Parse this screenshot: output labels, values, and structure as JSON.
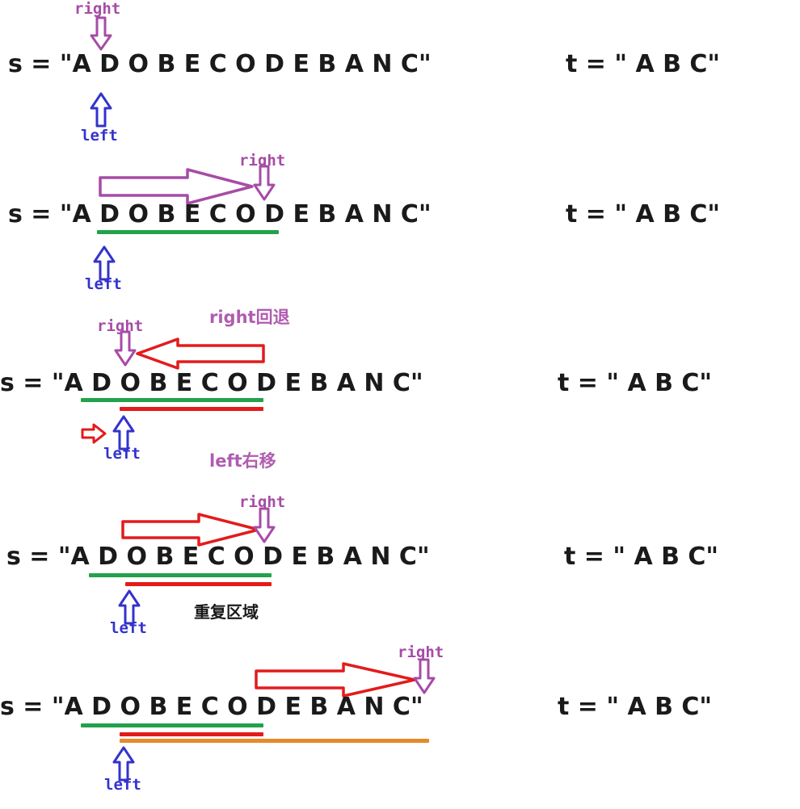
{
  "diagram": {
    "title": "Sliding window minimum-window-substring walkthrough",
    "colors": {
      "right_pointer": "#a64ca6",
      "left_pointer": "#3333cc",
      "window_green": "#22a24a",
      "window_red": "#e31b1b",
      "window_orange": "#e8892b",
      "text": "#1a1a1a",
      "background": "#ffffff"
    },
    "labels": {
      "right": "right",
      "left": "left",
      "right_retreat": "right回退",
      "left_shift_right": "left右移",
      "duplicate_region": "重复区域"
    },
    "strings": {
      "s_expr": "s = \"A D O B E C O D E B A N C\"",
      "t_expr": "t = \" A B C\"",
      "s_value": "ADOBECODEBANC",
      "t_value": "ABC"
    },
    "steps": [
      {
        "id": "step-1",
        "right_label": "right",
        "left_label": "left",
        "s_expr": "s = \"A D O B E C O D E B A N C\"",
        "t_expr": "t = \" A B C\"",
        "annotations": [],
        "underlines": []
      },
      {
        "id": "step-2",
        "right_label": "right",
        "left_label": "left",
        "s_expr": "s = \"A D O B E C O D E B A N C\"",
        "t_expr": "t = \" A B C\"",
        "annotations": [],
        "underlines": [
          "green"
        ],
        "move_arrow": "purple-right-arrow"
      },
      {
        "id": "step-3",
        "right_label": "right",
        "left_label": "left",
        "s_expr": "s = \"A D O B E C O D E B A N C\"",
        "t_expr": "t = \" A B C\"",
        "annotations": [
          "right回退",
          "left右移"
        ],
        "underlines": [
          "green",
          "red"
        ],
        "move_arrow": "red-left-arrow"
      },
      {
        "id": "step-4",
        "right_label": "right",
        "left_label": "left",
        "s_expr": "s = \"A D O B E C O D E B A N C\"",
        "t_expr": "t = \" A B C\"",
        "annotations": [
          "重复区域"
        ],
        "underlines": [
          "green",
          "red"
        ],
        "move_arrow": "red-right-arrow"
      },
      {
        "id": "step-5",
        "right_label": "right",
        "left_label": "left",
        "s_expr": "s = \"A D O B E C O D E B A N C\"",
        "t_expr": "t = \" A B C\"",
        "annotations": [],
        "underlines": [
          "green",
          "red",
          "orange"
        ],
        "move_arrow": "red-right-arrow"
      }
    ]
  }
}
